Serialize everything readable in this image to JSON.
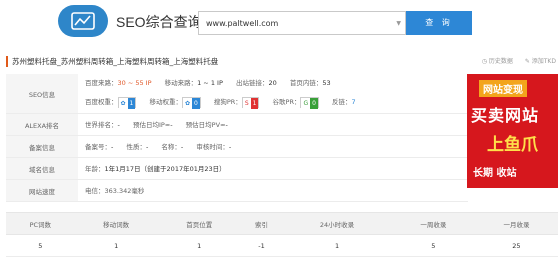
{
  "header": {
    "app_title": "SEO综合查询",
    "search_value": "www.paltwell.com",
    "query_label": "查 询"
  },
  "site_title": "苏州塑料托盘_苏州塑料周转箱_上海塑料周转箱_上海塑料托盘",
  "actions": {
    "history": "历史数据",
    "extra": "添加TKD"
  },
  "rows": {
    "seo": {
      "label": "SEO信息"
    },
    "alexa": {
      "label": "ALEXA排名"
    },
    "beian": {
      "label": "备案信息"
    },
    "domain": {
      "label": "域名信息"
    },
    "speed": {
      "label": "网站速度"
    }
  },
  "seo_line1": {
    "pc_label": "百度来路：",
    "pc_value": "30 ~ 55 IP",
    "mobile_label": "移动来路：",
    "mobile_value": "1 ~ 1 IP",
    "outlinks_label": "出站链接：",
    "outlinks_value": "20",
    "inlinks_label": "首页内链：",
    "inlinks_value": "53"
  },
  "seo_line2": {
    "br_label": "百度权重：",
    "br_value": "1",
    "mbr_label": "移动权重：",
    "mbr_value": "0",
    "sogou_label": "搜狗PR：",
    "sogou_value": "1",
    "google_label": "谷歌PR：",
    "google_value": "0",
    "backlinks_label": "反链：",
    "backlinks_value": "7"
  },
  "alexa": {
    "world_label": "世界排名：",
    "world_value": "-",
    "ip_label": "预估日均IP≈",
    "ip_value": "-",
    "pv_label": "预估日均PV≈",
    "pv_value": "-"
  },
  "beian": {
    "no_label": "备案号：",
    "no_value": "-",
    "type_label": "性质：",
    "type_value": "-",
    "name_label": "名称：",
    "name_value": "-",
    "time_label": "审核时间：",
    "time_value": "-"
  },
  "domain": {
    "age_label": "年龄：",
    "age_value": "1年1月17日（创建于2017年01月23日）"
  },
  "speed": {
    "label": "电信：",
    "value": "363.342毫秒"
  },
  "ad": {
    "line1": "网站变现",
    "line2": "买卖网站",
    "line3": "上鱼爪",
    "line4": "长期  收站"
  },
  "stats": {
    "headers": [
      "PC词数",
      "移动词数",
      "首页位置",
      "索引",
      "24小时收录",
      "一周收录",
      "一月收录"
    ],
    "values": [
      "5",
      "1",
      "1",
      "-1",
      "1",
      "5",
      "25"
    ]
  },
  "colors": {
    "accent": "#2d87d6",
    "ad_red": "#d6171d"
  }
}
